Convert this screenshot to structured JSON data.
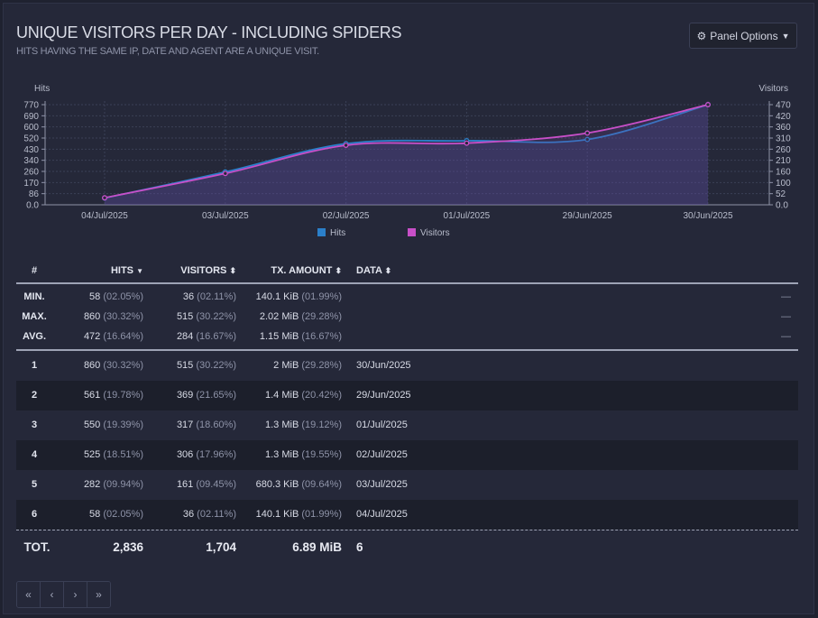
{
  "header": {
    "title": "UNIQUE VISITORS PER DAY - INCLUDING SPIDERS",
    "subtitle": "HITS HAVING THE SAME IP, DATE AND AGENT ARE A UNIQUE VISIT.",
    "panel_options_label": "Panel Options",
    "panel_options_icon": "gear-icon"
  },
  "chart_data": {
    "type": "area",
    "left_axis_label": "Hits",
    "right_axis_label": "Visitors",
    "categories": [
      "04/Jul/2025",
      "03/Jul/2025",
      "02/Jul/2025",
      "01/Jul/2025",
      "29/Jun/2025",
      "30/Jun/2025"
    ],
    "left_ticks": [
      "0.0",
      "86",
      "170",
      "260",
      "340",
      "430",
      "520",
      "600",
      "690",
      "770"
    ],
    "right_ticks": [
      "0.0",
      "52",
      "100",
      "160",
      "210",
      "260",
      "310",
      "360",
      "420",
      "470"
    ],
    "left_ylim": [
      0,
      860
    ],
    "right_ylim": [
      0,
      515
    ],
    "grid": true,
    "legend_position": "bottom",
    "series": [
      {
        "name": "Hits",
        "axis": "left",
        "color": "#2b7fc9",
        "values": [
          58,
          282,
          525,
          550,
          561,
          860
        ]
      },
      {
        "name": "Visitors",
        "axis": "right",
        "color": "#c84fc8",
        "values": [
          36,
          161,
          306,
          317,
          369,
          515
        ]
      }
    ]
  },
  "table": {
    "headers": {
      "num": "#",
      "hits": "HITS",
      "visitors": "VISITORS",
      "tx": "TX. AMOUNT",
      "data": "DATA"
    },
    "summary": [
      {
        "label": "MIN.",
        "hits": "58",
        "hits_pct": "(02.05%)",
        "visitors": "36",
        "visitors_pct": "(02.11%)",
        "tx": "140.1 KiB",
        "tx_pct": "(01.99%)",
        "data": "—"
      },
      {
        "label": "MAX.",
        "hits": "860",
        "hits_pct": "(30.32%)",
        "visitors": "515",
        "visitors_pct": "(30.22%)",
        "tx": "2.02 MiB",
        "tx_pct": "(29.28%)",
        "data": "—"
      },
      {
        "label": "AVG.",
        "hits": "472",
        "hits_pct": "(16.64%)",
        "visitors": "284",
        "visitors_pct": "(16.67%)",
        "tx": "1.15 MiB",
        "tx_pct": "(16.67%)",
        "data": "—"
      }
    ],
    "rows": [
      {
        "num": "1",
        "hits": "860",
        "hits_pct": "(30.32%)",
        "visitors": "515",
        "visitors_pct": "(30.22%)",
        "tx": "2 MiB",
        "tx_pct": "(29.28%)",
        "data": "30/Jun/2025"
      },
      {
        "num": "2",
        "hits": "561",
        "hits_pct": "(19.78%)",
        "visitors": "369",
        "visitors_pct": "(21.65%)",
        "tx": "1.4 MiB",
        "tx_pct": "(20.42%)",
        "data": "29/Jun/2025"
      },
      {
        "num": "3",
        "hits": "550",
        "hits_pct": "(19.39%)",
        "visitors": "317",
        "visitors_pct": "(18.60%)",
        "tx": "1.3 MiB",
        "tx_pct": "(19.12%)",
        "data": "01/Jul/2025"
      },
      {
        "num": "4",
        "hits": "525",
        "hits_pct": "(18.51%)",
        "visitors": "306",
        "visitors_pct": "(17.96%)",
        "tx": "1.3 MiB",
        "tx_pct": "(19.55%)",
        "data": "02/Jul/2025"
      },
      {
        "num": "5",
        "hits": "282",
        "hits_pct": "(09.94%)",
        "visitors": "161",
        "visitors_pct": "(09.45%)",
        "tx": "680.3 KiB",
        "tx_pct": "(09.64%)",
        "data": "03/Jul/2025"
      },
      {
        "num": "6",
        "hits": "58",
        "hits_pct": "(02.05%)",
        "visitors": "36",
        "visitors_pct": "(02.11%)",
        "tx": "140.1 KiB",
        "tx_pct": "(01.99%)",
        "data": "04/Jul/2025"
      }
    ],
    "total": {
      "label": "TOT.",
      "hits": "2,836",
      "visitors": "1,704",
      "tx": "6.89 MiB",
      "data": "6"
    }
  },
  "pagination": {
    "first": "«",
    "prev": "‹",
    "next": "›",
    "last": "»"
  }
}
